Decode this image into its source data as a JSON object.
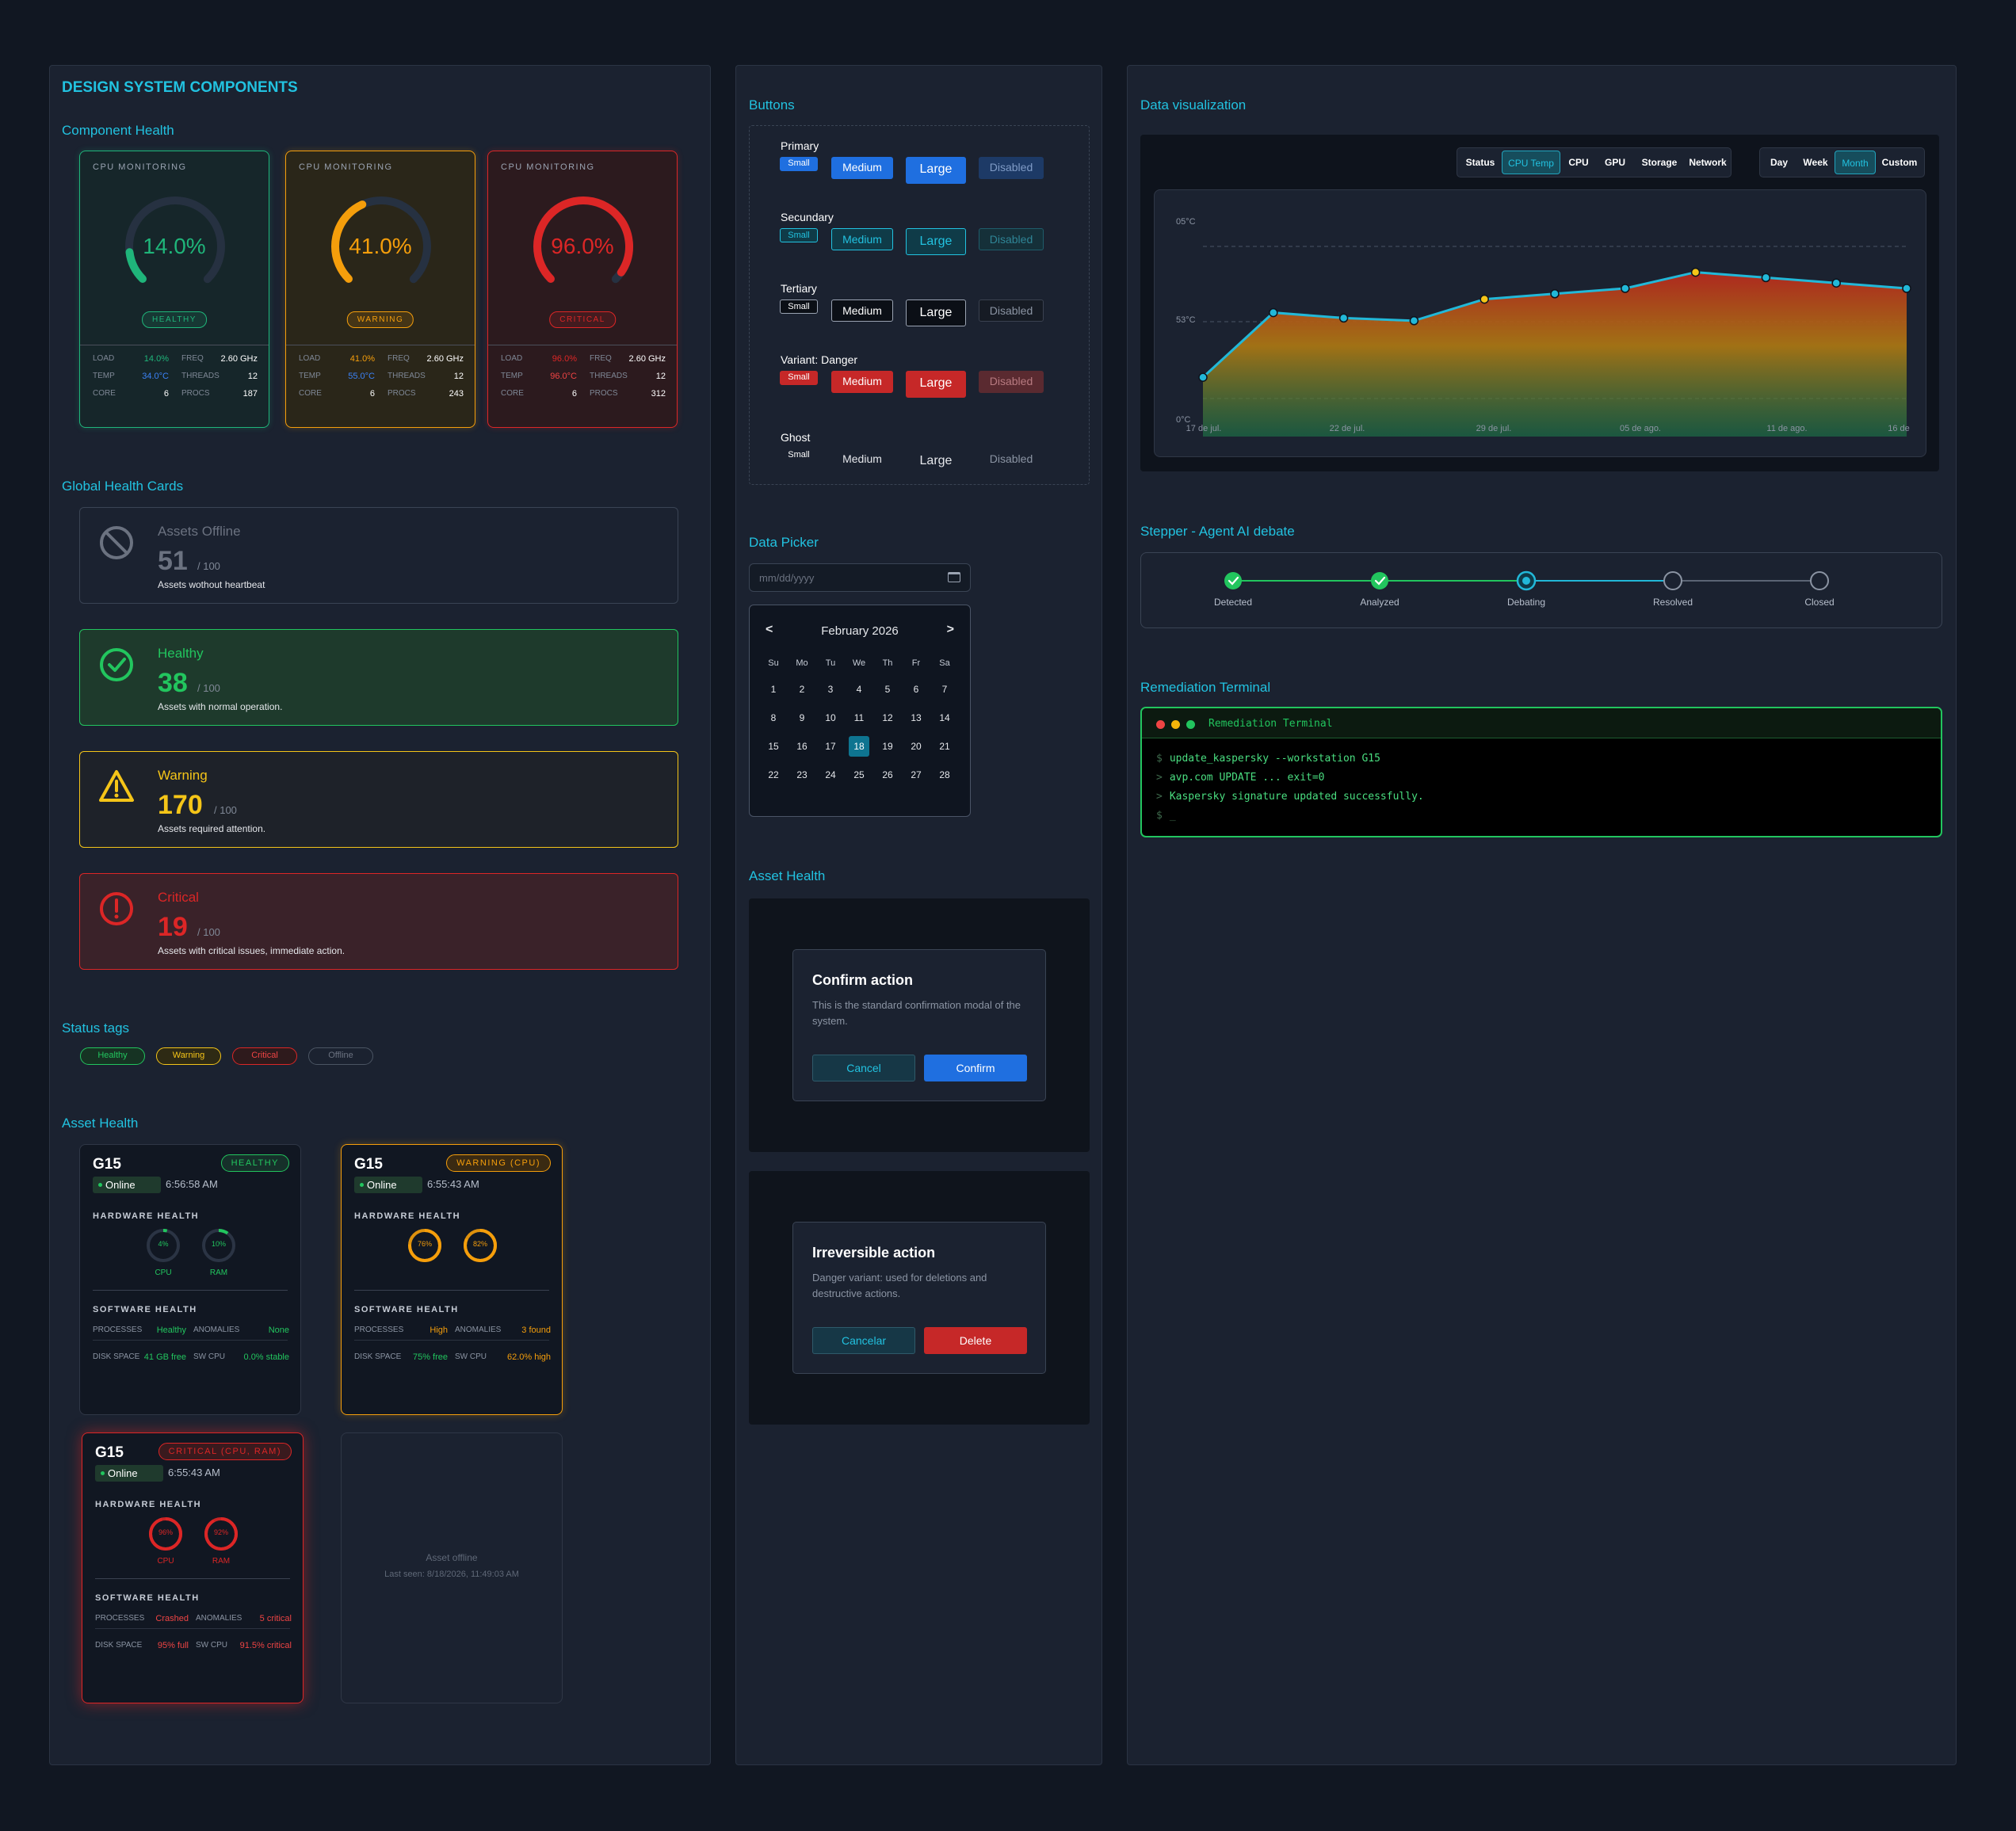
{
  "page": {
    "title": "DESIGN SYSTEM COMPONENTS"
  },
  "sections": {
    "component_health": "Component Health",
    "global_health": "Global Health Cards",
    "status_tags": "Status tags",
    "asset_health_left": "Asset Health",
    "buttons": "Buttons",
    "data_picker": "Data Picker",
    "asset_health_mid": "Asset Health",
    "data_viz": "Data visualization",
    "stepper": "Stepper - Agent AI debate",
    "terminal": "Remediation Terminal"
  },
  "cpu_cards": [
    {
      "label": "CPU MONITORING",
      "value": "14.0%",
      "percent": 14,
      "badge": "HEALTHY",
      "color": "#1fb57a",
      "load": "14.0%",
      "temp": "34.0°C",
      "core": "6",
      "freq": "2.60 GHz",
      "threads": "12",
      "procs": "187",
      "temp_color": "#3b82f6"
    },
    {
      "label": "CPU MONITORING",
      "value": "41.0%",
      "percent": 41,
      "badge": "WARNING",
      "color": "#f59e0b",
      "load": "41.0%",
      "temp": "55.0°C",
      "core": "6",
      "freq": "2.60 GHz",
      "threads": "12",
      "procs": "243",
      "temp_color": "#3b82f6"
    },
    {
      "label": "CPU MONITORING",
      "value": "96.0%",
      "percent": 96,
      "badge": "CRITICAL",
      "color": "#dc2626",
      "load": "96.0%",
      "temp": "96.0°C",
      "core": "6",
      "freq": "2.60 GHz",
      "threads": "12",
      "procs": "312",
      "temp_color": "#ef4444"
    }
  ],
  "cpu_stat_labels": {
    "load": "LOAD",
    "temp": "TEMP",
    "core": "CORE",
    "freq": "FREQ",
    "threads": "THREADS",
    "procs": "PROCS"
  },
  "global_cards": [
    {
      "title": "Assets Offline",
      "count": "51",
      "total": "/ 100",
      "desc": "Assets wothout heartbeat",
      "icon": "ban-icon"
    },
    {
      "title": "Healthy",
      "count": "38",
      "total": "/ 100",
      "desc": "Assets with normal operation.",
      "icon": "check-circle-icon"
    },
    {
      "title": "Warning",
      "count": "170",
      "total": "/ 100",
      "desc": "Assets required attention.",
      "icon": "warning-triangle-icon"
    },
    {
      "title": "Critical",
      "count": "19",
      "total": "/ 100",
      "desc": "Assets with critical issues, immediate action.",
      "icon": "alert-circle-icon"
    }
  ],
  "status_tags": [
    "Healthy",
    "Warning",
    "Critical",
    "Offline"
  ],
  "asset_cards": [
    {
      "name": "G15",
      "status": "HEALTHY",
      "online": "Online",
      "time": "6:56:58 AM",
      "hw": "HARDWARE HEALTH",
      "sw": "SOFTWARE HEALTH",
      "cpu": "4%",
      "ram": "10%",
      "cpu_label": "CPU",
      "ram_label": "RAM",
      "processes": "Healthy",
      "anomalies": "None",
      "disk": "41 GB free",
      "swcpu": "0.0% stable"
    },
    {
      "name": "G15",
      "status": "WARNING (CPU)",
      "online": "Online",
      "time": "6:55:43 AM",
      "hw": "HARDWARE HEALTH",
      "sw": "SOFTWARE HEALTH",
      "cpu": "76%",
      "ram": "82%",
      "processes": "High",
      "anomalies": "3 found",
      "disk": "75% free",
      "swcpu": "62.0% high"
    },
    {
      "name": "G15",
      "status": "CRITICAL (CPU, RAM)",
      "online": "Online",
      "time": "6:55:43 AM",
      "hw": "HARDWARE HEALTH",
      "sw": "SOFTWARE HEALTH",
      "cpu": "96%",
      "ram": "92%",
      "cpu_label": "CPU",
      "ram_label": "RAM",
      "processes": "Crashed",
      "anomalies": "5 critical",
      "disk": "95% full",
      "swcpu": "91.5% critical"
    }
  ],
  "asset_keys": {
    "processes": "PROCESSES",
    "anomalies": "ANOMALIES",
    "disk": "DISK SPACE",
    "swcpu": "SW CPU"
  },
  "asset_offline": {
    "title": "Asset offline",
    "last_seen": "Last seen: 8/18/2026, 11:49:03 AM"
  },
  "buttons": {
    "rows": [
      {
        "label": "Primary",
        "small": "Small",
        "medium": "Medium",
        "large": "Large",
        "disabled": "Disabled"
      },
      {
        "label": "Secundary",
        "small": "Small",
        "medium": "Medium",
        "large": "Large",
        "disabled": "Disabled"
      },
      {
        "label": "Tertiary",
        "small": "Small",
        "medium": "Medium",
        "large": "Large",
        "disabled": "Disabled"
      },
      {
        "label": "Variant: Danger",
        "small": "Small",
        "medium": "Medium",
        "large": "Large",
        "disabled": "Disabled"
      },
      {
        "label": "Ghost",
        "small": "Small",
        "medium": "Medium",
        "large": "Large",
        "disabled": "Disabled"
      }
    ]
  },
  "date_picker": {
    "placeholder": "mm/dd/yyyy",
    "month": "February 2026",
    "prev": "<",
    "next": ">",
    "weekdays": [
      "Su",
      "Mo",
      "Tu",
      "We",
      "Th",
      "Fr",
      "Sa"
    ],
    "weeks": [
      [
        "1",
        "2",
        "3",
        "4",
        "5",
        "6",
        "7"
      ],
      [
        "8",
        "9",
        "10",
        "11",
        "12",
        "13",
        "14"
      ],
      [
        "15",
        "16",
        "17",
        "18",
        "19",
        "20",
        "21"
      ],
      [
        "22",
        "23",
        "24",
        "25",
        "26",
        "27",
        "28"
      ]
    ],
    "selected": "18"
  },
  "modals": [
    {
      "title": "Confirm action",
      "body": "This is the standard confirmation modal of the system.",
      "cancel": "Cancel",
      "confirm": "Confirm"
    },
    {
      "title": "Irreversible action",
      "body": "Danger variant: used for deletions and destructive actions.",
      "cancel": "Cancelar",
      "confirm": "Delete"
    }
  ],
  "chart_tabs": {
    "metrics": [
      "Status",
      "CPU Temp",
      "CPU",
      "GPU",
      "Storage",
      "Network"
    ],
    "active_metric": "CPU Temp",
    "ranges": [
      "Day",
      "Week",
      "Month",
      "Custom"
    ],
    "active_range": "Month"
  },
  "chart_data": {
    "type": "area",
    "x": [
      "17 de jul.",
      "22 de jul.",
      "29 de jul.",
      "05 de ago.",
      "11 de ago.",
      "16 de"
    ],
    "y_ticks": [
      "05°C",
      "53°C",
      "0°C"
    ],
    "points": [
      22,
      46,
      44,
      43,
      51,
      53,
      55,
      61,
      59,
      57,
      55
    ],
    "highlight_indices": [
      4,
      7
    ],
    "ylim": [
      0,
      80
    ],
    "grid": true
  },
  "stepper": {
    "steps": [
      "Detected",
      "Analyzed",
      "Debating",
      "Resolved",
      "Closed"
    ],
    "done": 2,
    "current": 2
  },
  "terminal": {
    "title": "Remediation Terminal",
    "lines": [
      {
        "prompt": "$",
        "text": "update_kaspersky --workstation G15"
      },
      {
        "prompt": ">",
        "text": "avp.com UPDATE ... exit=0"
      },
      {
        "prompt": ">",
        "text": "Kaspersky signature updated successfully."
      },
      {
        "prompt": "$",
        "text": "_"
      }
    ]
  },
  "colors": {
    "accent": "#22c2e0",
    "healthy": "#22c55e",
    "warning": "#f5c518",
    "critical": "#dc2626",
    "primary": "#1f6fe0"
  }
}
